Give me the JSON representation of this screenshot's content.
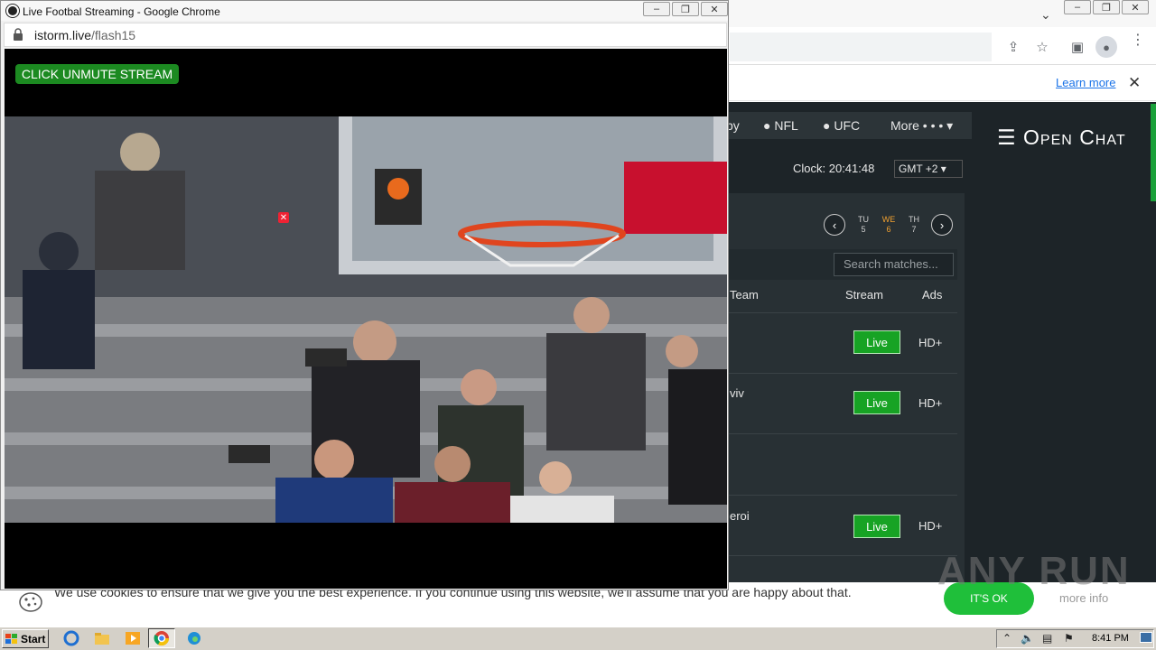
{
  "popup": {
    "title": "Live Footbal Streaming - Google Chrome",
    "url_host": "istorm.live",
    "url_path": "/flash15",
    "unmute_label": "CLICK UNMUTE STREAM",
    "close_ad_glyph": "✕"
  },
  "background_site": {
    "learn_more": "Learn more",
    "nav": {
      "item_partial": "by",
      "nfl": "NFL",
      "ufc": "UFC",
      "more": "More • • •"
    },
    "open_chat": "☰ Open Chat",
    "clock": "Clock: 20:41:48",
    "timezone": "GMT +2 ▾",
    "days": [
      {
        "abbr": "TU",
        "num": "5"
      },
      {
        "abbr": "WE",
        "num": "6"
      },
      {
        "abbr": "TH",
        "num": "7"
      }
    ],
    "search_placeholder": "Search matches...",
    "columns": {
      "team": "Team",
      "stream": "Stream",
      "ads": "Ads"
    },
    "rows": [
      {
        "team": "",
        "stream": "Live",
        "ads": "HD+"
      },
      {
        "team": "viv",
        "stream": "Live",
        "ads": "HD+"
      },
      {
        "team": "",
        "stream": "",
        "ads": ""
      },
      {
        "team": "eroi",
        "stream": "Live",
        "ads": "HD+"
      }
    ],
    "cookie_text": "We use cookies to ensure that we give you the best experience. If you continue using this website, we'll assume that you are happy about that.",
    "cookie_ok": "IT'S OK",
    "cookie_more": "more info"
  },
  "watermark": "ANY RUN",
  "taskbar": {
    "start": "Start",
    "time": "8:41 PM"
  },
  "colors": {
    "live_green": "#17a324",
    "unmute_green": "#1c8a21",
    "site_dark": "#1d2428",
    "active_day": "#f0a030"
  },
  "icons": [
    "lock-icon",
    "share-icon",
    "star-icon",
    "sidebar-icon",
    "profile-icon",
    "menu-icon",
    "cookie-icon",
    "chevron-left-icon",
    "chevron-right-icon"
  ]
}
